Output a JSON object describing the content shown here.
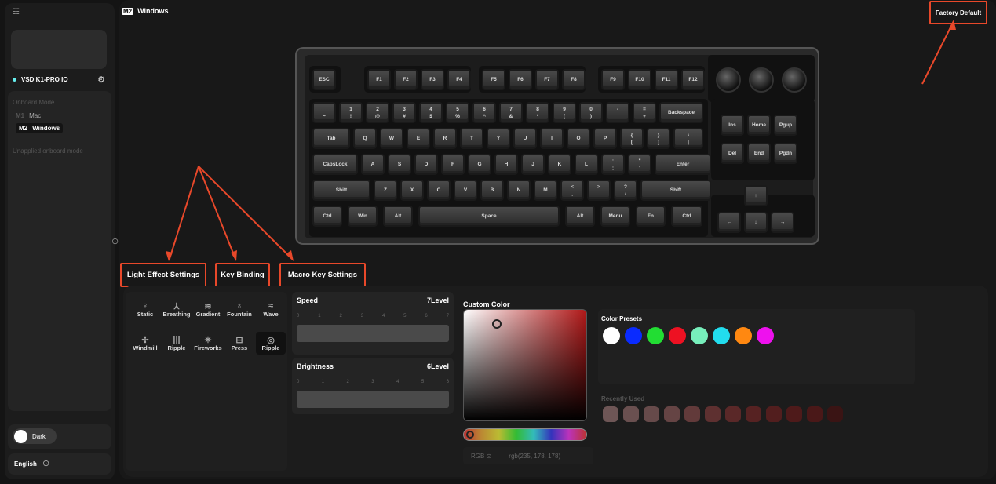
{
  "sidebar": {
    "device_name": "VSD K1-PRO IO",
    "onboard_mode_label": "Onboard Mode",
    "modes": [
      {
        "tag": "M1",
        "name": "Mac"
      },
      {
        "tag": "M2",
        "name": "Windows"
      }
    ],
    "unapplied_label": "Unapplied onboard mode",
    "theme_label": "Dark",
    "language": "English"
  },
  "header": {
    "mode_tag": "M2",
    "mode_name": "Windows",
    "factory_default": "Factory Default"
  },
  "tabs": [
    "Light Effect Settings",
    "Key Binding",
    "Macro Key Settings"
  ],
  "keyboard": {
    "fn_row": [
      "ESC",
      "F1",
      "F2",
      "F3",
      "F4",
      "F5",
      "F6",
      "F7",
      "F8",
      "F9",
      "F10",
      "F11",
      "F12"
    ],
    "row1": [
      [
        "`",
        "~"
      ],
      [
        "1",
        "!"
      ],
      [
        "2",
        "@"
      ],
      [
        "3",
        "#"
      ],
      [
        "4",
        "$"
      ],
      [
        "5",
        "%"
      ],
      [
        "6",
        "^"
      ],
      [
        "7",
        "&"
      ],
      [
        "8",
        "*"
      ],
      [
        "9",
        "("
      ],
      [
        "0",
        ")"
      ],
      [
        "-",
        "_"
      ],
      [
        "=",
        "+"
      ],
      [
        "Backspace",
        ""
      ]
    ],
    "row2": [
      "Tab",
      "Q",
      "W",
      "E",
      "R",
      "T",
      "Y",
      "U",
      "I",
      "O",
      "P",
      "{ [",
      "} ]",
      "\\ |"
    ],
    "row3": [
      "CapsLock",
      "A",
      "S",
      "D",
      "F",
      "G",
      "H",
      "J",
      "K",
      "L",
      ": ;",
      "\" '",
      "Enter"
    ],
    "row4": [
      "Shift",
      "Z",
      "X",
      "C",
      "V",
      "B",
      "N",
      "M",
      "< ,",
      "> .",
      "? /",
      "Shift"
    ],
    "row5": [
      "Ctrl",
      "Win",
      "Alt",
      "Space",
      "Alt",
      "Menu",
      "Fn",
      "Ctrl"
    ],
    "nav": [
      "Ins",
      "Home",
      "Pgup",
      "Del",
      "End",
      "Pgdn"
    ],
    "arrows": [
      "↑",
      "←",
      "↓",
      "→"
    ]
  },
  "effects": [
    {
      "name": "Static",
      "icon": "bulb-icon"
    },
    {
      "name": "Breathing",
      "icon": "breath-icon"
    },
    {
      "name": "Gradient",
      "icon": "gradient-icon"
    },
    {
      "name": "Fountain",
      "icon": "fountain-icon"
    },
    {
      "name": "Wave",
      "icon": "wave-icon"
    },
    {
      "name": "Windmill",
      "icon": "windmill-icon"
    },
    {
      "name": "Ripple",
      "icon": "ripple-bars-icon"
    },
    {
      "name": "Fireworks",
      "icon": "fireworks-icon"
    },
    {
      "name": "Press",
      "icon": "press-icon"
    },
    {
      "name": "Ripple",
      "icon": "ripple-circle-icon"
    }
  ],
  "speed": {
    "label": "Speed",
    "value_label": "7Level",
    "value": 7,
    "max": 7,
    "ticks": [
      "0",
      "1",
      "2",
      "3",
      "4",
      "5",
      "6",
      "7"
    ]
  },
  "brightness": {
    "label": "Brightness",
    "value_label": "6Level",
    "value": 6,
    "max": 6,
    "ticks": [
      "0",
      "1",
      "2",
      "3",
      "4",
      "5",
      "6"
    ]
  },
  "custom_color": {
    "label": "Custom Color",
    "mode": "RGB",
    "value": "rgb(235, 178, 178)"
  },
  "presets": {
    "label": "Color Presets",
    "colors": [
      "#ffffff",
      "#0a2bff",
      "#22dd33",
      "#ee1122",
      "#77eebb",
      "#22ddee",
      "#ff8811",
      "#ee11ee"
    ]
  },
  "recent": {
    "label": "Recently Used",
    "colors": [
      "#6e5656",
      "#6a5050",
      "#664a4a",
      "#654444",
      "#623a3a",
      "#5e3030",
      "#5a2828",
      "#562222",
      "#521e1e",
      "#4e1a1a",
      "#4a1818",
      "#3a1414"
    ]
  }
}
